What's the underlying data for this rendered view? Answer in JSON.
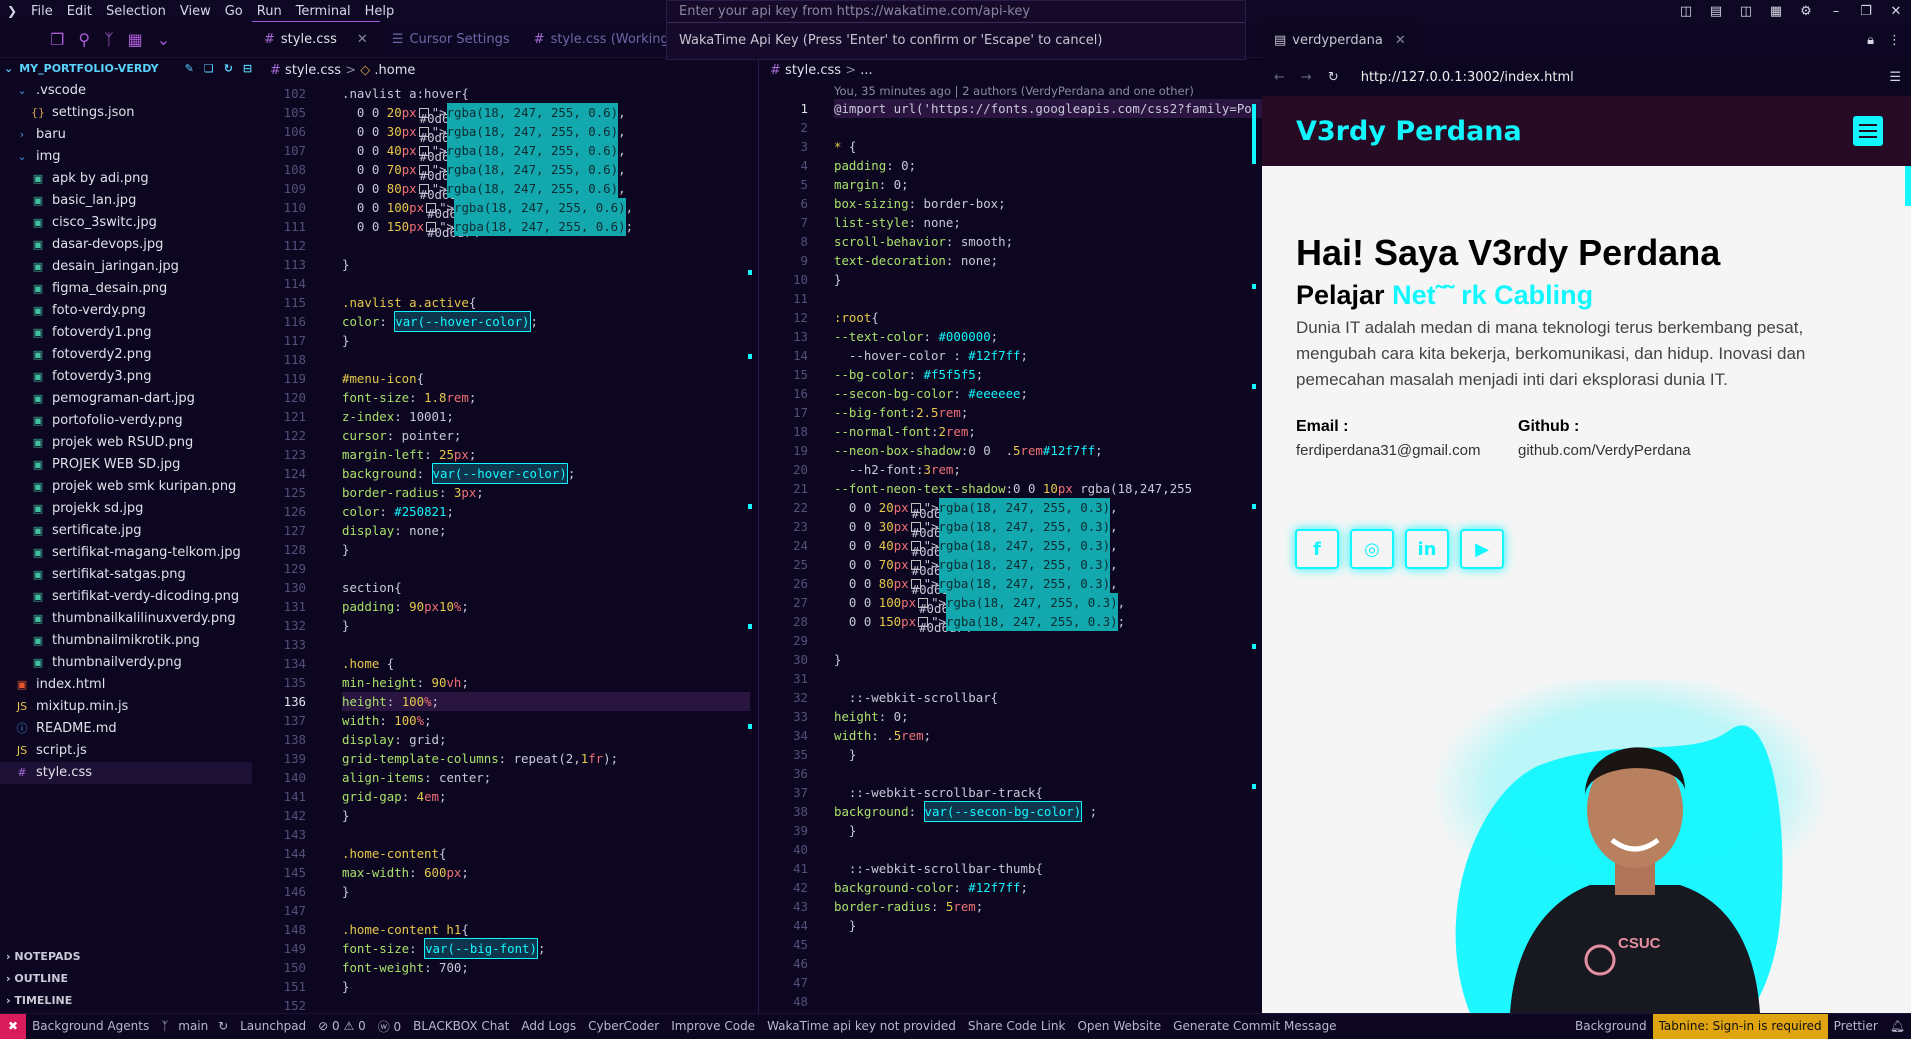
{
  "menu": [
    "File",
    "Edit",
    "Selection",
    "View",
    "Go",
    "Run",
    "Terminal",
    "Help"
  ],
  "waka": {
    "placeholder": "Enter your api key from https://wakatime.com/api-key",
    "hint": "WakaTime Api Key (Press 'Enter' to confirm or 'Escape' to cancel)"
  },
  "explorer": {
    "root": "MY_PORTFOLIO-VERDY",
    "items": [
      {
        "name": ".vscode",
        "type": "folder-open",
        "depth": 1
      },
      {
        "name": "settings.json",
        "type": "json",
        "depth": 2
      },
      {
        "name": "baru",
        "type": "folder",
        "depth": 1
      },
      {
        "name": "img",
        "type": "folder-open",
        "depth": 1
      },
      {
        "name": "apk by adi.png",
        "type": "img",
        "depth": 2
      },
      {
        "name": "basic_lan.jpg",
        "type": "img",
        "depth": 2
      },
      {
        "name": "cisco_3switc.jpg",
        "type": "img",
        "depth": 2
      },
      {
        "name": "dasar-devops.jpg",
        "type": "img",
        "depth": 2
      },
      {
        "name": "desain_jaringan.jpg",
        "type": "img",
        "depth": 2
      },
      {
        "name": "figma_desain.png",
        "type": "img",
        "depth": 2
      },
      {
        "name": "foto-verdy.png",
        "type": "img",
        "depth": 2
      },
      {
        "name": "fotoverdy1.png",
        "type": "img",
        "depth": 2
      },
      {
        "name": "fotoverdy2.png",
        "type": "img",
        "depth": 2
      },
      {
        "name": "fotoverdy3.png",
        "type": "img",
        "depth": 2
      },
      {
        "name": "pemograman-dart.jpg",
        "type": "img",
        "depth": 2
      },
      {
        "name": "portofolio-verdy.png",
        "type": "img",
        "depth": 2
      },
      {
        "name": "projek web RSUD.png",
        "type": "img",
        "depth": 2
      },
      {
        "name": "PROJEK WEB SD.jpg",
        "type": "img",
        "depth": 2
      },
      {
        "name": "projek web smk kuripan.png",
        "type": "img",
        "depth": 2
      },
      {
        "name": "projekk sd.jpg",
        "type": "img",
        "depth": 2
      },
      {
        "name": "sertificate.jpg",
        "type": "img",
        "depth": 2
      },
      {
        "name": "sertifikat-magang-telkom.jpg",
        "type": "img",
        "depth": 2
      },
      {
        "name": "sertifikat-satgas.png",
        "type": "img",
        "depth": 2
      },
      {
        "name": "sertifikat-verdy-dicoding.png",
        "type": "img",
        "depth": 2
      },
      {
        "name": "thumbnailkalilinuxverdy.png",
        "type": "img",
        "depth": 2
      },
      {
        "name": "thumbnailmikrotik.png",
        "type": "img",
        "depth": 2
      },
      {
        "name": "thumbnailverdy.png",
        "type": "img",
        "depth": 2
      },
      {
        "name": "index.html",
        "type": "html",
        "depth": 1
      },
      {
        "name": "mixitup.min.js",
        "type": "js",
        "depth": 1
      },
      {
        "name": "README.md",
        "type": "md",
        "depth": 1
      },
      {
        "name": "script.js",
        "type": "js",
        "depth": 1
      },
      {
        "name": "style.css",
        "type": "css",
        "depth": 1
      }
    ],
    "sections": [
      "NOTEPADS",
      "OUTLINE",
      "TIMELINE"
    ]
  },
  "tabs": [
    {
      "label": "style.css"
    },
    {
      "label": "Cursor Settings"
    },
    {
      "label": "style.css (Working Tr"
    }
  ],
  "breadcrumb1": {
    "file": "style.css",
    "sep": ">",
    "sym": ".home"
  },
  "breadcrumb2": {
    "file": "style.css",
    "sep": ">",
    "sym": "..."
  },
  "blame": "You, 35 minutes ago | 2 authors (VerdyPerdana and one other)",
  "editor1": {
    "numbers": [
      "102",
      "105",
      "106",
      "107",
      "108",
      "109",
      "110",
      "111",
      "112",
      "113",
      "114",
      "115",
      "116",
      "117",
      "118",
      "119",
      "120",
      "121",
      "122",
      "123",
      "124",
      "125",
      "126",
      "127",
      "128",
      "129",
      "130",
      "131",
      "132",
      "133",
      "134",
      "135",
      "136",
      "137",
      "138",
      "139",
      "140",
      "141",
      "142",
      "143",
      "144",
      "145",
      "146",
      "147",
      "148",
      "149",
      "150",
      "151",
      "152"
    ],
    "lines": [
      ".navlist a:hover{",
      "  0 0 20px rgba(18, 247, 255, 0.6),",
      "  0 0 30px rgba(18, 247, 255, 0.6),",
      "  0 0 40px rgba(18, 247, 255, 0.6),",
      "  0 0 70px rgba(18, 247, 255, 0.6),",
      "  0 0 80px rgba(18, 247, 255, 0.6),",
      "  0 0 100px rgba(18, 247, 255, 0.6),",
      "  0 0 150px rgba(18, 247, 255, 0.6);",
      "",
      "}",
      "",
      ".navlist a.active{",
      "  color: var(--hover-color);",
      "}",
      "",
      "#menu-icon{",
      "  font-size: 1.8rem;",
      "  z-index: 10001;",
      "  cursor: pointer;",
      "  margin-left: 25px;",
      "  background: var(--hover-color);",
      "  border-radius: 3px;",
      "  color: #250821;",
      "  display: none;",
      "}",
      "",
      "section{",
      " padding: 90px 10%;",
      "}",
      "",
      ".home {",
      " min-height: 90vh;",
      " height: 100%;",
      " width: 100%;",
      " display: grid;",
      " grid-template-columns: repeat(2,1fr);",
      " align-items: center;",
      " grid-gap: 4em;",
      "}",
      "",
      ".home-content{",
      " max-width: 600px;",
      "}",
      "",
      ".home-content h1{",
      " font-size: var(--big-font);",
      " font-weight: 700;",
      "}",
      ""
    ]
  },
  "editor2": {
    "numbers": [
      "1",
      "2",
      "3",
      "4",
      "5",
      "6",
      "7",
      "8",
      "9",
      "10",
      "11",
      "12",
      "13",
      "14",
      "15",
      "16",
      "17",
      "18",
      "19",
      "20",
      "21",
      "22",
      "23",
      "24",
      "25",
      "26",
      "27",
      "28",
      "29",
      "30",
      "31",
      "32",
      "33",
      "34",
      "35",
      "36",
      "37",
      "38",
      "39",
      "40",
      "41",
      "42",
      "43",
      "44",
      "45",
      "46",
      "47",
      "48"
    ],
    "lines": [
      "@import url('https://fonts.googleapis.com/css2?family=Po",
      "",
      "* {",
      "  padding: 0;",
      "  margin: 0;",
      "  box-sizing: border-box;",
      "  list-style: none;",
      "  scroll-behavior: smooth;",
      "  text-decoration: none;",
      "}",
      "",
      ":root{",
      "  --text-color: #000000;",
      "  --hover-color : #12f7ff;",
      "  --bg-color: #f5f5f5;",
      "  --secon-bg-color: #eeeeee;",
      "  --big-font:2.5rem;",
      "  --normal-font:2rem;",
      "  --neon-box-shadow:0 0  .5rem #12f7ff;",
      "  --h2-font:3rem;",
      "  --font-neon-text-shadow:0 0 10px rgba(18,247,255",
      "  0 0 20px rgba(18, 247, 255, 0.3),",
      "  0 0 30px rgba(18, 247, 255, 0.3),",
      "  0 0 40px rgba(18, 247, 255, 0.3),",
      "  0 0 70px rgba(18, 247, 255, 0.3),",
      "  0 0 80px rgba(18, 247, 255, 0.3),",
      "  0 0 100px rgba(18, 247, 255, 0.3),",
      "  0 0 150px rgba(18, 247, 255, 0.3);",
      "",
      "}",
      "",
      "  ::-webkit-scrollbar{",
      "    height: 0;",
      "    width: .5rem;",
      "  }",
      "",
      "  ::-webkit-scrollbar-track{",
      "    background: var(--secon-bg-color) ;",
      "  }",
      "",
      "  ::-webkit-scrollbar-thumb{",
      "    background-color: #12f7ff;",
      "    border-radius: 5rem;",
      "  }",
      "",
      "",
      "",
      ""
    ]
  },
  "browser": {
    "tab": "verdyperdana",
    "url": "http://127.0.0.1:3002/index.html",
    "brand": "V3rdy Perdana",
    "h1": "Hai! Saya V3rdy Perdana",
    "h2_prefix": "Pelajar ",
    "h2_anim": "Net˜˜ rk Cabling",
    "about": "Dunia IT adalah medan di mana teknologi terus berkembang pesat, mengubah cara kita bekerja, berkomunikasi, dan hidup. Inovasi dan pemecahan masalah menjadi inti dari eksplorasi dunia IT.",
    "email_label": "Email :",
    "email": "ferdiperdana31@gmail.com",
    "github_label": "Github :",
    "github": "github.com/VerdyPerdana",
    "social": [
      "f",
      "◎",
      "in",
      "▶"
    ],
    "accent": "#12f7ff",
    "header_bg": "#270a24",
    "shirt_text": "CSUC"
  },
  "status": [
    "Background Agents",
    "main",
    "Launchpad",
    "⊘ 0 ⚠ 0",
    "ⓦ 0",
    "BLACKBOX Chat",
    "Add Logs",
    "CyberCoder",
    "Improve Code",
    "WakaTime api key not provided",
    "Share Code Link",
    "Open Website",
    "Generate Commit Message",
    "Background",
    "Tabnine: Sign-in is required",
    "Prettier"
  ]
}
